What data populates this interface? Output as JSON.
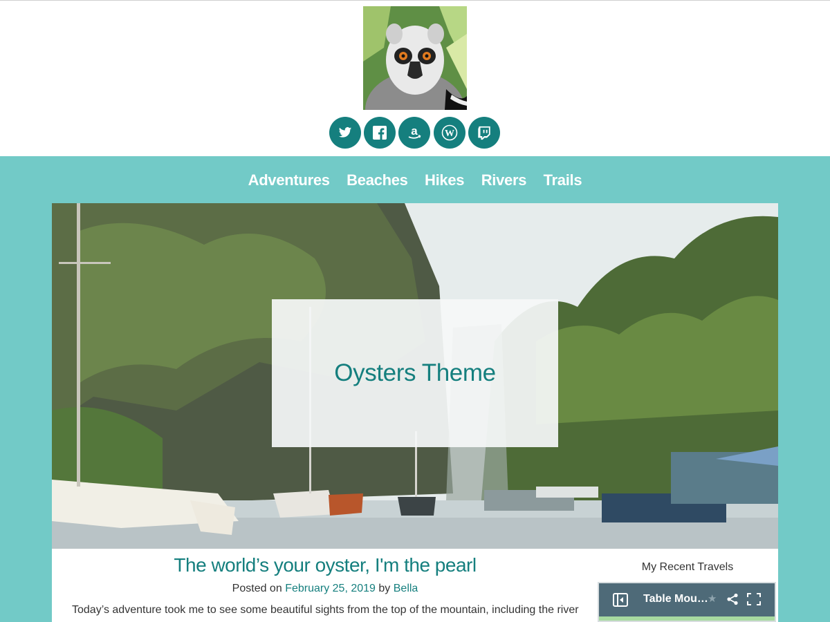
{
  "social": {
    "buttons": [
      {
        "name": "twitter-icon",
        "glyph": "twitter"
      },
      {
        "name": "facebook-icon",
        "glyph": "facebook"
      },
      {
        "name": "amazon-icon",
        "glyph": "a"
      },
      {
        "name": "wordpress-icon",
        "glyph": "wordpress"
      },
      {
        "name": "twitch-icon",
        "glyph": "twitch"
      }
    ]
  },
  "nav": {
    "items": [
      "Adventures",
      "Beaches",
      "Hikes",
      "Rivers",
      "Trails"
    ]
  },
  "hero": {
    "site_title": "Oysters Theme"
  },
  "post": {
    "title": "The world’s your oyster, I'm the pearl",
    "meta_posted_on": "Posted on",
    "date": "February 25, 2019",
    "meta_by": "by",
    "author": "Bella",
    "excerpt": "Today’s adventure took me to see some beautiful sights from the top of the mountain, including the river"
  },
  "sidebar": {
    "title": "My Recent Travels",
    "map": {
      "title": "Table Mou…"
    }
  },
  "colors": {
    "accent": "#157f7e",
    "band": "#72cac7",
    "nav_text": "#ffffff",
    "widget_bar": "#4e6a78"
  }
}
